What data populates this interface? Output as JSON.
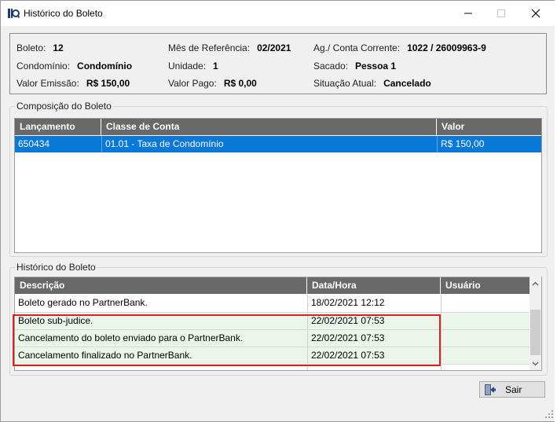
{
  "window": {
    "title": "Histórico do Boleto"
  },
  "info": {
    "boleto": {
      "label": "Boleto:",
      "value": "12"
    },
    "mes_referencia": {
      "label": "Mês de Referência:",
      "value": "02/2021"
    },
    "ag_conta": {
      "label": "Ag./ Conta Corrente:",
      "value": "1022 / 26009963-9"
    },
    "condominio": {
      "label": "Condomínio:",
      "value": "Condomínio"
    },
    "unidade": {
      "label": "Unidade:",
      "value": "1"
    },
    "sacado": {
      "label": "Sacado:",
      "value": "Pessoa 1"
    },
    "valor_emissao": {
      "label": "Valor Emissão:",
      "value": "R$ 150,00"
    },
    "valor_pago": {
      "label": "Valor Pago:",
      "value": "R$ 0,00"
    },
    "situacao": {
      "label": "Situação Atual:",
      "value": "Cancelado"
    }
  },
  "composicao": {
    "title": "Composição do Boleto",
    "headers": [
      "Lançamento",
      "Classe de Conta",
      "Valor"
    ],
    "rows": [
      {
        "lancamento": "650434",
        "classe": "01.01 - Taxa de Condomínio",
        "valor": "R$ 150,00"
      }
    ]
  },
  "historico": {
    "title": "Histórico do Boleto",
    "headers": [
      "Descrição",
      "Data/Hora",
      "Usuário"
    ],
    "rows": [
      {
        "descricao": "Boleto gerado no PartnerBank.",
        "data": "18/02/2021 12:12",
        "usuario": ""
      },
      {
        "descricao": "Boleto sub-judice.",
        "data": "22/02/2021 07:53",
        "usuario": ""
      },
      {
        "descricao": "Cancelamento do boleto enviado para o PartnerBank.",
        "data": "22/02/2021 07:53",
        "usuario": ""
      },
      {
        "descricao": "Cancelamento finalizado no PartnerBank.",
        "data": "22/02/2021 07:53",
        "usuario": ""
      }
    ]
  },
  "footer": {
    "sair_label": "Sair"
  },
  "colors": {
    "selection": "#0a78d7",
    "header": "#696969",
    "highlight": "#d62222",
    "row_green": "#eaf6ea"
  },
  "icons": [
    "app-icon",
    "minimize-icon",
    "maximize-icon",
    "close-icon",
    "exit-door-icon",
    "scroll-up-icon",
    "scroll-down-icon",
    "resize-grip-icon"
  ]
}
